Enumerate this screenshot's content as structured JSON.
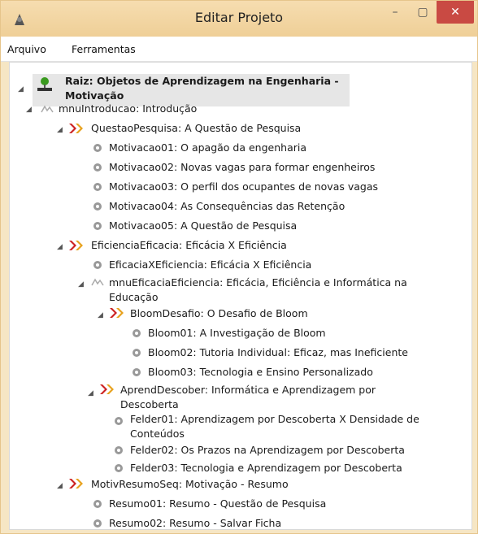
{
  "window": {
    "title": "Editar Projeto",
    "min": "–",
    "max": "▢",
    "close": "✕"
  },
  "menu": [
    "Arquivo",
    "Ferramentas"
  ],
  "tree": {
    "root": "Raiz: Objetos de Aprendizagem na Engenharia -",
    "root_cont": "Motivação",
    "mnuIntroducao": "mnuIntroducao: Introdução",
    "QuestaoPesquisa": "QuestaoPesquisa: A Questão de Pesquisa",
    "m01": "Motivacao01: O apagão da engenharia",
    "m02": "Motivacao02: Novas vagas para formar engenheiros",
    "m03": "Motivacao03: O perfil dos ocupantes de novas vagas",
    "m04": "Motivacao04: As Consequências das Retenção",
    "m05": "Motivacao05: A Questão de Pesquisa",
    "EficienciaEficacia": "EficienciaEficacia: Eficácia X Eficiência",
    "EficaciaXEficiencia": "EficaciaXEficiencia: Eficácia X Eficiência",
    "mnuEficaciaEficiencia": "mnuEficaciaEficiencia: Eficácia, Eficiência e Informática na",
    "mnuEficaciaEficiencia_cont": "Educação",
    "BloomDesafio": "BloomDesafio: O Desafio de Bloom",
    "b01": "Bloom01: A Investigação de Bloom",
    "b02": "Bloom02: Tutoria Individual: Eficaz, mas Ineficiente",
    "b03": "Bloom03: Tecnologia e Ensino Personalizado",
    "AprendDescober": "AprendDescober: Informática e Aprendizagem por",
    "AprendDescober_cont": "Descoberta",
    "f01": "Felder01: Aprendizagem por Descoberta X Densidade de",
    "f01_cont": "Conteúdos",
    "f02": "Felder02: Os Prazos na Aprendizagem por Descoberta",
    "f03": "Felder03: Tecnologia e Aprendizagem por Descoberta",
    "MotivResumoSeq": "MotivResumoSeq: Motivação - Resumo",
    "r01": "Resumo01: Resumo - Questão de Pesquisa",
    "r02": "Resumo02: Resumo - Salvar Ficha"
  }
}
